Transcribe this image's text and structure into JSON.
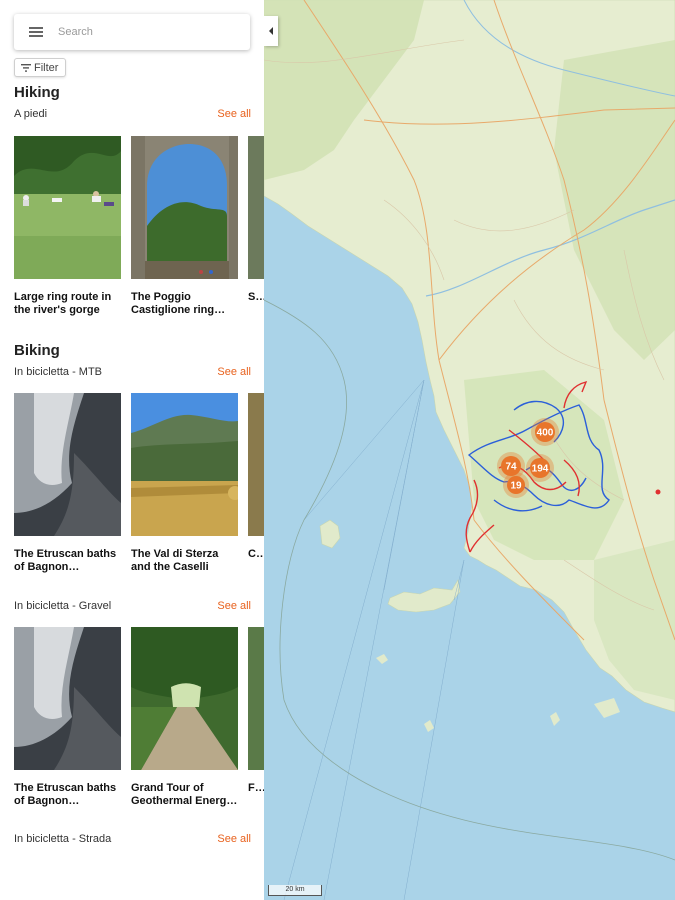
{
  "search": {
    "placeholder": "Search"
  },
  "filter": {
    "label": "Filter"
  },
  "sections": [
    {
      "title": "Hiking",
      "subsections": [
        {
          "label": "A piedi",
          "see_all": "See all",
          "cards": [
            {
              "title": "Large ring route in the river's gorge"
            },
            {
              "title": "The Poggio Castiglione ring…"
            },
            {
              "title": "S… f…"
            }
          ]
        }
      ]
    },
    {
      "title": "Biking",
      "subsections": [
        {
          "label": "In bicicletta - MTB",
          "see_all": "See all",
          "cards": [
            {
              "title": "The Etruscan baths of Bagnon…"
            },
            {
              "title": "The Val di Sterza and the Caselli Forest"
            },
            {
              "title": "C… G…"
            }
          ]
        },
        {
          "label": "In bicicletta - Gravel",
          "see_all": "See all",
          "cards": [
            {
              "title": "The Etruscan baths of Bagnon…"
            },
            {
              "title": "Grand Tour of Geothermal Energ…"
            },
            {
              "title": "F… V…"
            }
          ]
        },
        {
          "label": "In bicicletta - Strada",
          "see_all": "See all"
        }
      ]
    }
  ],
  "map": {
    "clusters": [
      {
        "count": "400"
      },
      {
        "count": "74"
      },
      {
        "count": "194"
      },
      {
        "count": "19"
      }
    ],
    "scale": "20 km",
    "colors": {
      "sea": "#a9d2e6",
      "land": "#e9efd6",
      "cluster": "#e8752b",
      "route_blue": "#2b5fd9",
      "route_red": "#e03030"
    }
  },
  "colors": {
    "accent": "#e8621e"
  }
}
